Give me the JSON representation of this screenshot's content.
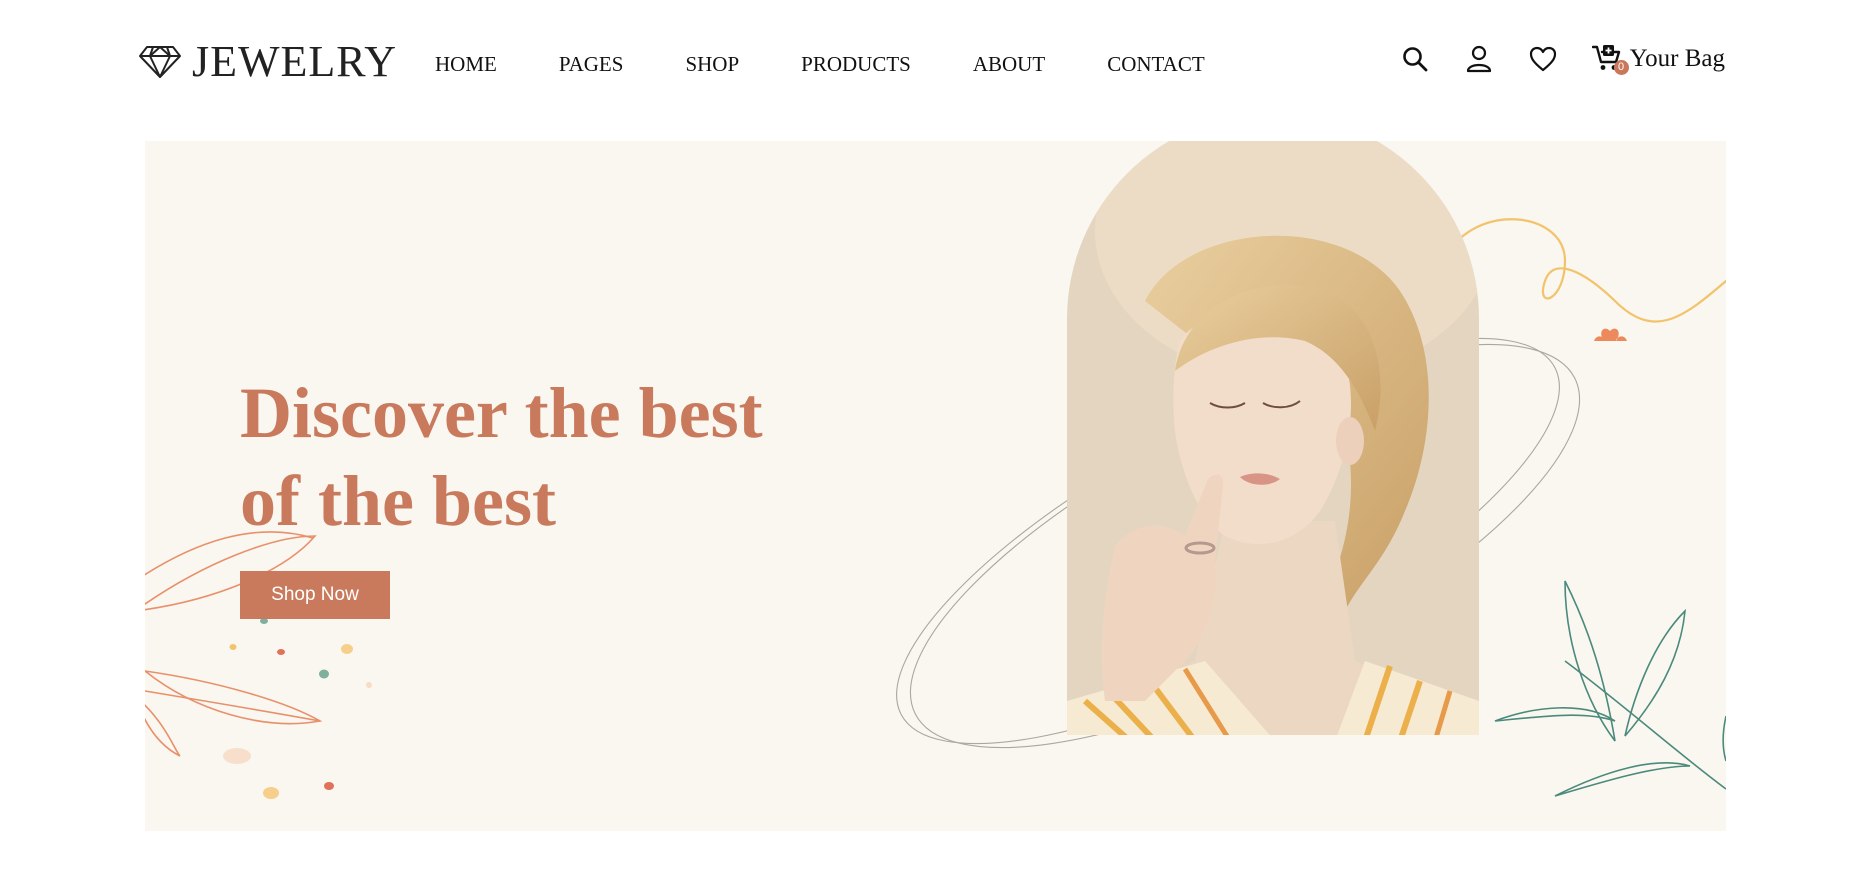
{
  "brand": {
    "name": "JEWELRY",
    "icon": "diamond-icon"
  },
  "nav": {
    "items": [
      {
        "label": "HOME"
      },
      {
        "label": "PAGES"
      },
      {
        "label": "SHOP"
      },
      {
        "label": "PRODUCTS"
      },
      {
        "label": "ABOUT"
      },
      {
        "label": "CONTACT"
      }
    ]
  },
  "actions": {
    "search_icon": "search-icon",
    "account_icon": "user-icon",
    "wishlist_icon": "heart-icon",
    "cart_icon": "cart-icon",
    "cart_count": "0",
    "bag_label": "Your Bag"
  },
  "hero": {
    "title_line1": "Discover the best",
    "title_line2": "of the best",
    "cta_label": "Shop Now"
  },
  "colors": {
    "accent": "#c97a5c",
    "hero_background": "#faf6f0",
    "leaf_green": "#4a8a7c",
    "leaf_orange": "#e8906a",
    "squiggle_yellow": "#f2c36a"
  }
}
